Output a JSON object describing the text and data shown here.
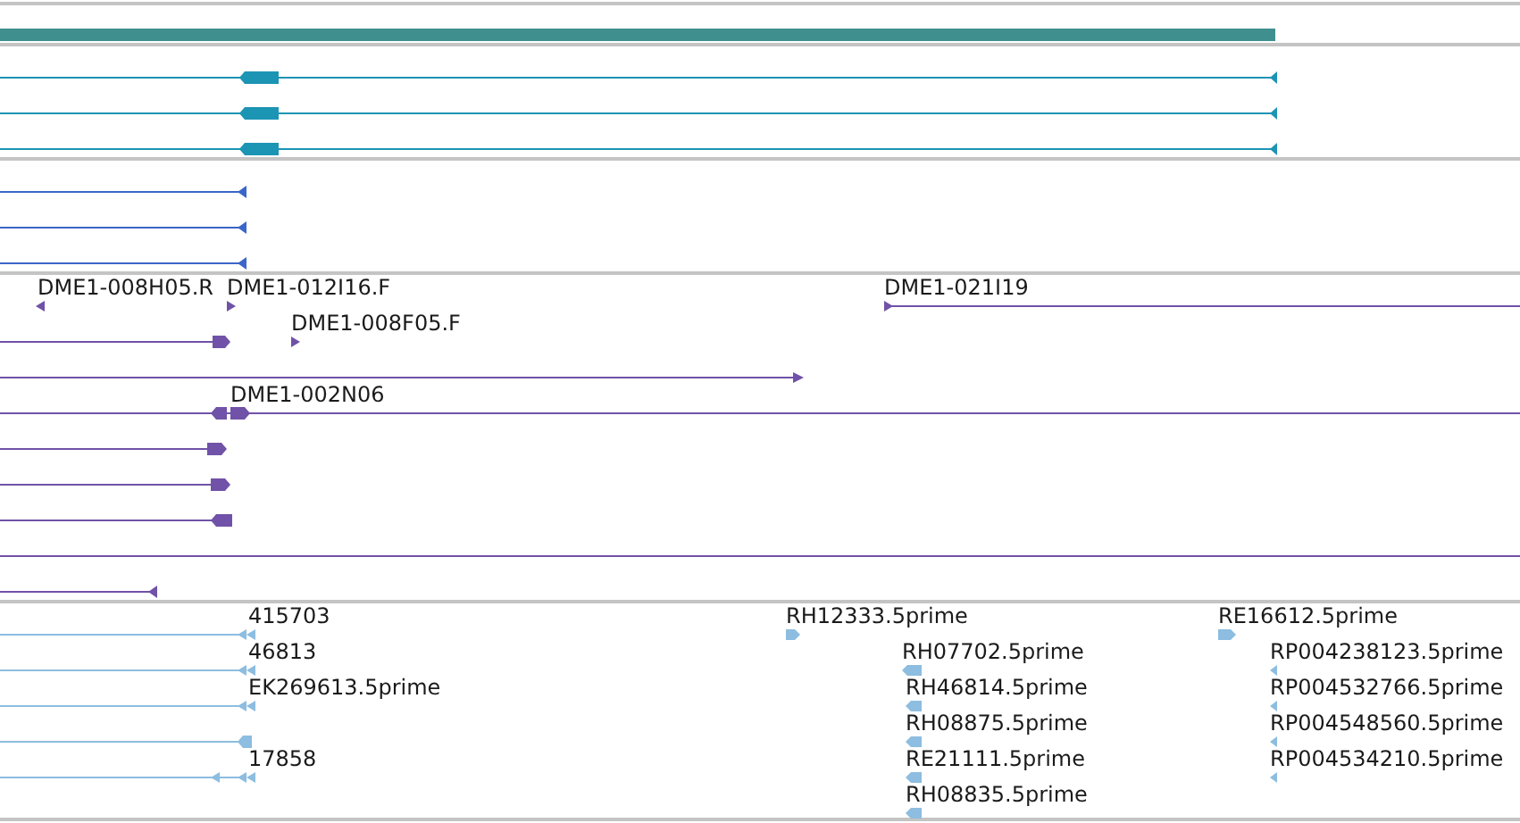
{
  "tracks": [
    {
      "kind": "bar",
      "color": "#3f8f8f"
    },
    {
      "kind": "features",
      "color": "#1c94b4",
      "features": [
        {
          "kind": "arrow",
          "reverse": true
        },
        {
          "kind": "arrow",
          "reverse": true
        },
        {
          "kind": "arrow",
          "reverse": true
        }
      ]
    },
    {
      "kind": "features",
      "color": "#3a66c8",
      "features": [
        {
          "kind": "arrow",
          "reverse": true
        },
        {
          "kind": "arrow",
          "reverse": true
        },
        {
          "kind": "arrow",
          "reverse": true
        }
      ]
    },
    {
      "kind": "features",
      "color": "#7052a8",
      "features": [
        {
          "kind": "arrow",
          "label": "DME1-008H05.R",
          "reverse": true
        },
        {
          "kind": "arrow",
          "label": "DME1-012I16.F",
          "reverse": false
        },
        {
          "kind": "arrow",
          "label": "DME1-021I19",
          "reverse": false
        },
        {
          "kind": "arrow",
          "label": "DME1-008F05.F",
          "reverse": false
        },
        {
          "kind": "arrow",
          "reverse": false
        },
        {
          "kind": "arrow",
          "reverse": false
        },
        {
          "kind": "arrow",
          "label": "DME1-002N06",
          "reverse": false
        },
        {
          "kind": "arrow",
          "reverse": false
        },
        {
          "kind": "arrow",
          "reverse": false
        },
        {
          "kind": "arrow",
          "reverse": true
        },
        {
          "kind": "line"
        },
        {
          "kind": "arrow",
          "reverse": true
        }
      ]
    },
    {
      "kind": "features",
      "color": "#8dbde0",
      "features": [
        {
          "kind": "arrow",
          "label": "415703",
          "reverse": true
        },
        {
          "kind": "arrow",
          "label": "46813",
          "reverse": true
        },
        {
          "kind": "arrow",
          "label": "EK269613.5prime",
          "reverse": true
        },
        {
          "kind": "arrow",
          "reverse": true
        },
        {
          "kind": "arrow",
          "label": "17858",
          "reverse": true
        },
        {
          "kind": "arrow",
          "label": "RH12333.5prime",
          "reverse": false
        },
        {
          "kind": "arrow",
          "label": "RH07702.5prime",
          "reverse": true
        },
        {
          "kind": "arrow",
          "label": "RH46814.5prime",
          "reverse": true
        },
        {
          "kind": "arrow",
          "label": "RH08875.5prime",
          "reverse": true
        },
        {
          "kind": "arrow",
          "label": "RE21111.5prime",
          "reverse": true
        },
        {
          "kind": "arrow",
          "label": "RH08835.5prime",
          "reverse": true
        },
        {
          "kind": "arrow",
          "label": "RE16612.5prime",
          "reverse": false
        },
        {
          "kind": "arrow",
          "label": "RP004238123.5prime",
          "reverse": true
        },
        {
          "kind": "arrow",
          "label": "RP004532766.5prime",
          "reverse": true
        },
        {
          "kind": "arrow",
          "label": "RP004548560.5prime",
          "reverse": true
        },
        {
          "kind": "arrow",
          "label": "RP004534210.5prime",
          "reverse": true
        }
      ]
    }
  ]
}
